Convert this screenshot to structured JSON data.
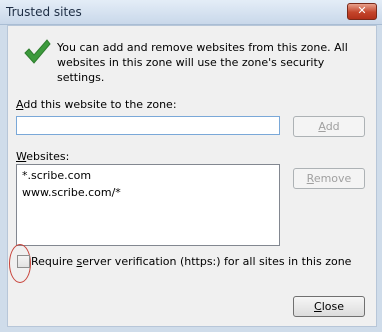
{
  "window": {
    "title": "Trusted sites",
    "close_glyph": "✕"
  },
  "intro": {
    "icon": "green-checkmark-icon",
    "text": "You can add and remove websites from this zone. All websites in this zone will use the zone's security settings."
  },
  "add": {
    "label_key": "A",
    "label_rest": "dd this website to the zone:",
    "value": "",
    "button_key": "A",
    "button_rest": "dd",
    "button_enabled": false
  },
  "websites": {
    "label_key": "W",
    "label_rest": "ebsites:",
    "items": [
      "*.scribe.com",
      "www.scribe.com/*"
    ],
    "remove_key": "R",
    "remove_rest": "emove",
    "remove_enabled": false
  },
  "verify": {
    "label_pre": "Require ",
    "label_key": "s",
    "label_rest": "erver verification (https:) for all sites in this zone",
    "checked": false
  },
  "footer": {
    "close_key": "C",
    "close_rest": "lose"
  },
  "colors": {
    "accent": "#3c9a3c",
    "title_close": "#c4452b",
    "annotation_circle": "#c8433a"
  }
}
